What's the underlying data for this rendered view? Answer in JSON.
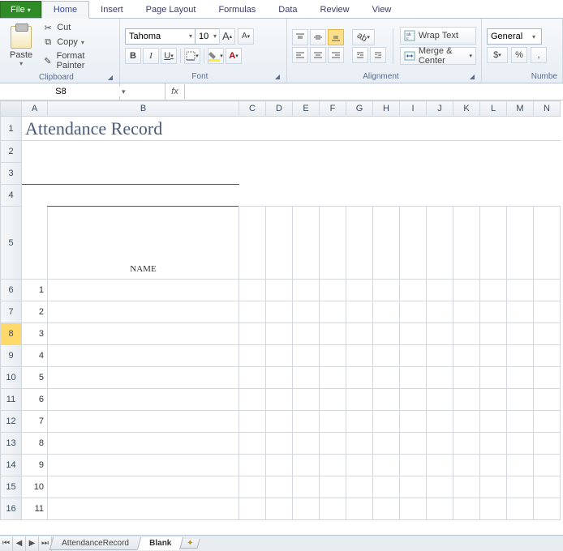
{
  "tabs": {
    "file": "File",
    "items": [
      "Home",
      "Insert",
      "Page Layout",
      "Formulas",
      "Data",
      "Review",
      "View"
    ],
    "active": "Home"
  },
  "ribbon": {
    "clipboard": {
      "label": "Clipboard",
      "paste": "Paste",
      "cut": "Cut",
      "copy": "Copy",
      "format_painter": "Format Painter"
    },
    "font": {
      "label": "Font",
      "name": "Tahoma",
      "size": "10",
      "grow": "A",
      "shrink": "A",
      "bold": "B",
      "italic": "I",
      "underline": "U"
    },
    "alignment": {
      "label": "Alignment",
      "wrap": "Wrap Text",
      "merge": "Merge & Center"
    },
    "number": {
      "label": "Numbe",
      "format": "General",
      "currency": "$",
      "percent": "%"
    }
  },
  "namebox": "S8",
  "fx": "fx",
  "columns": [
    "A",
    "B",
    "C",
    "D",
    "E",
    "F",
    "G",
    "H",
    "I",
    "J",
    "K",
    "L",
    "M",
    "N"
  ],
  "col_widths": {
    "A": 32,
    "B": 236,
    "other": 33
  },
  "rows": {
    "count": 16,
    "heights": {
      "1": 30,
      "2": 14,
      "3": 14,
      "4": 14,
      "5": 90,
      "default": 27
    },
    "selected": 8
  },
  "cells": {
    "A1": "Attendance Record",
    "B5": "NAME",
    "A6": "1",
    "A7": "2",
    "A8": "3",
    "A9": "4",
    "A10": "5",
    "A11": "6",
    "A12": "7",
    "A13": "8",
    "A14": "9",
    "A15": "10",
    "A16": "11"
  },
  "sheet_tabs": {
    "items": [
      "AttendanceRecord",
      "Blank"
    ],
    "active": "Blank"
  }
}
